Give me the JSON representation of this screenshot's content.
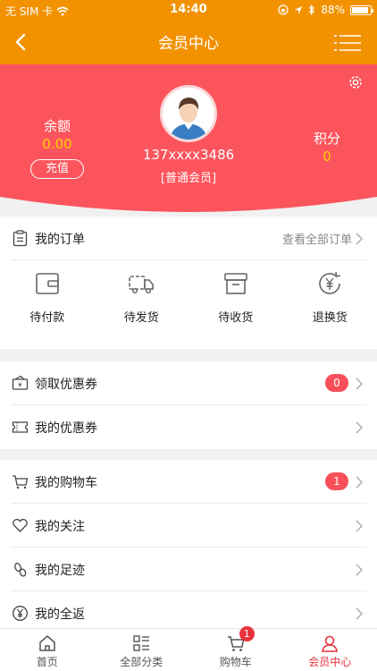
{
  "status_bar": {
    "carrier": "无 SIM 卡",
    "time": "14:40",
    "battery": "88%",
    "battery_level": 0.88
  },
  "nav": {
    "title": "会员中心"
  },
  "colors": {
    "nav_bg": "#f29200",
    "hero_bg": "#fc545c",
    "accent_yellow": "#ffd100",
    "badge_red": "#f7505a",
    "active_tab": "#e8333c"
  },
  "profile": {
    "phone": "137xxxx3486",
    "level": "[普通会员]",
    "balance_label": "余额",
    "balance_value": "0.00",
    "recharge_label": "充值",
    "points_label": "积分",
    "points_value": "0"
  },
  "orders": {
    "title": "我的订单",
    "view_all": "查看全部订单",
    "items": [
      {
        "label": "待付款",
        "icon": "wallet-icon"
      },
      {
        "label": "待发货",
        "icon": "truck-icon"
      },
      {
        "label": "待收货",
        "icon": "box-icon"
      },
      {
        "label": "退换货",
        "icon": "refund-icon"
      }
    ]
  },
  "coupons": {
    "items": [
      {
        "label": "领取优惠券",
        "badge": "0",
        "icon": "coupon-receive-icon"
      },
      {
        "label": "我的优惠券",
        "icon": "coupon-icon"
      }
    ]
  },
  "menu": {
    "items": [
      {
        "label": "我的购物车",
        "badge": "1",
        "icon": "cart-icon"
      },
      {
        "label": "我的关注",
        "icon": "heart-icon"
      },
      {
        "label": "我的足迹",
        "icon": "footprint-icon"
      },
      {
        "label": "我的全返",
        "icon": "yen-icon"
      }
    ]
  },
  "tabbar": {
    "items": [
      {
        "label": "首页",
        "icon": "home-icon"
      },
      {
        "label": "全部分类",
        "icon": "category-icon"
      },
      {
        "label": "购物车",
        "icon": "cart-icon",
        "badge": "1"
      },
      {
        "label": "会员中心",
        "icon": "user-icon",
        "active": true
      }
    ]
  }
}
